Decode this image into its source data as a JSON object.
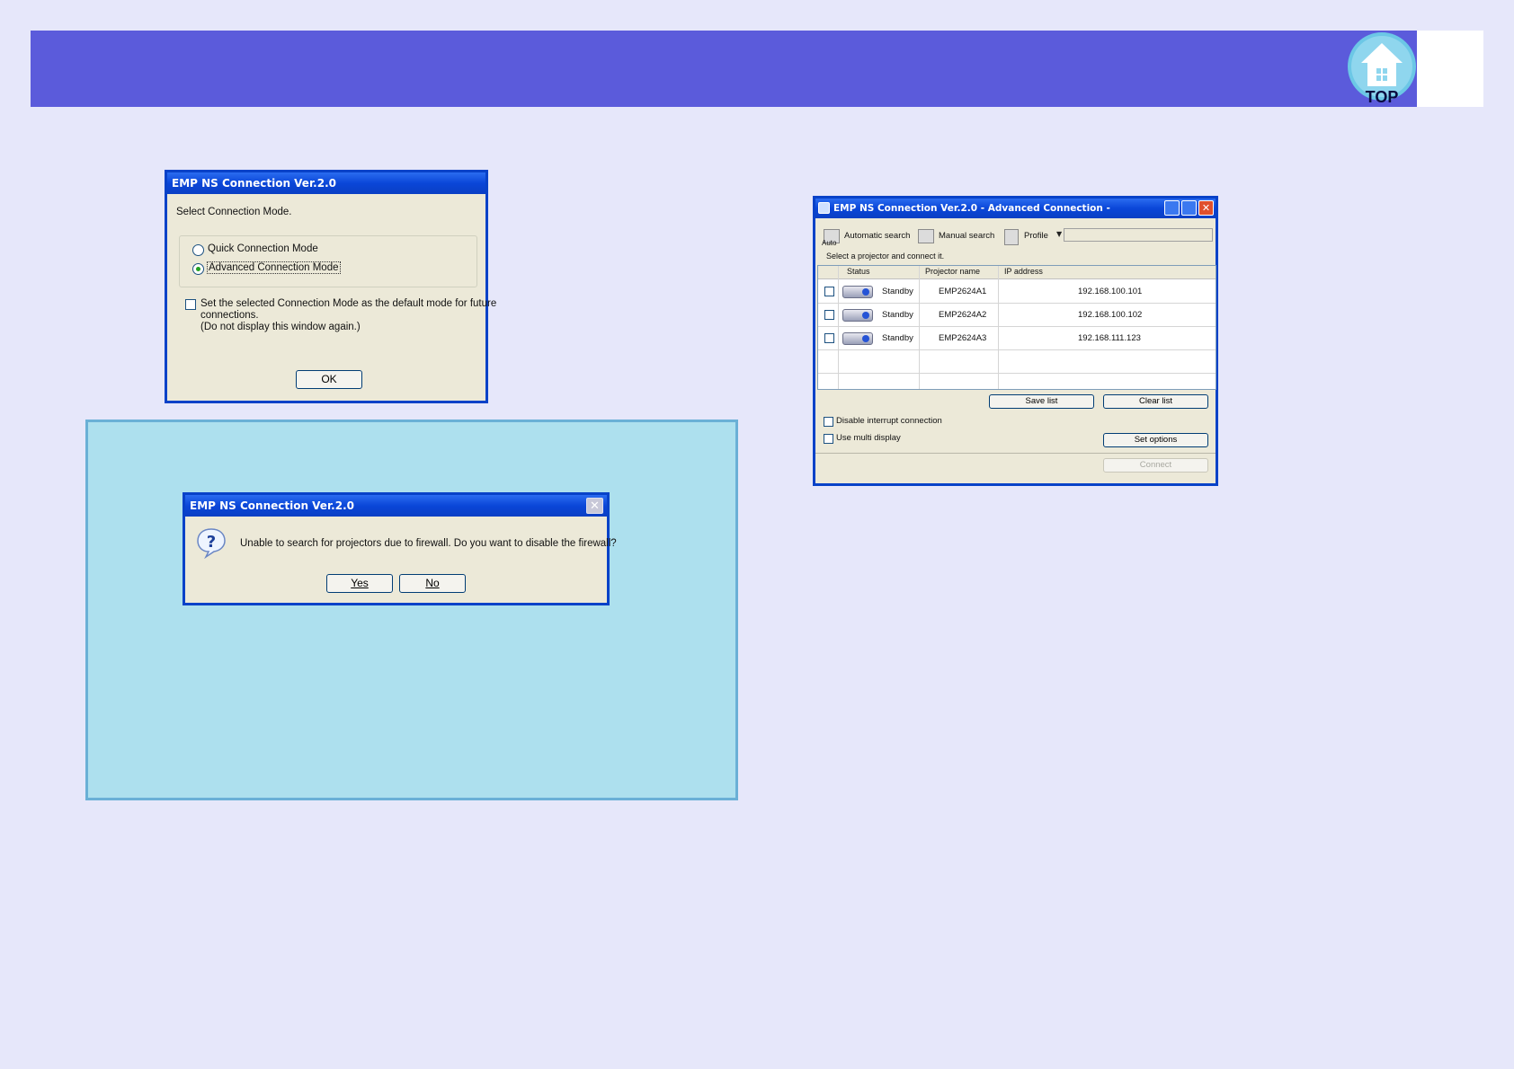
{
  "header": {
    "top_button_label": "TOP"
  },
  "dialog_mode": {
    "title": "EMP NS Connection Ver.2.0",
    "prompt": "Select Connection Mode.",
    "options": [
      {
        "label": "Quick Connection Mode",
        "selected": false
      },
      {
        "label": "Advanced Connection Mode",
        "selected": true
      }
    ],
    "default_checkbox_line1": "Set the selected Connection Mode as the default mode for future",
    "default_checkbox_line2": "connections.",
    "default_checkbox_line3": "(Do not display this window again.)",
    "ok_label": "OK"
  },
  "dialog_firewall": {
    "title": "EMP NS Connection Ver.2.0",
    "message": "Unable to search for projectors due to firewall. Do you want to disable the firewall?",
    "yes_label": "Yes",
    "no_label": "No"
  },
  "advanced_window": {
    "title": "EMP NS Connection Ver.2.0 - Advanced Connection -",
    "toolbar": {
      "auto_icon_text": "Auto",
      "automatic_search": "Automatic search",
      "manual_search": "Manual search",
      "profile": "Profile"
    },
    "instruction": "Select a projector and connect it.",
    "columns": [
      "Status",
      "Projector name",
      "IP address"
    ],
    "rows": [
      {
        "status": "Standby",
        "name": "EMP2624A1",
        "ip": "192.168.100.101"
      },
      {
        "status": "Standby",
        "name": "EMP2624A2",
        "ip": "192.168.100.102"
      },
      {
        "status": "Standby",
        "name": "EMP2624A3",
        "ip": "192.168.111.123"
      }
    ],
    "save_list": "Save list",
    "clear_list": "Clear list",
    "disable_interrupt": "Disable interrupt connection",
    "use_multi_display": "Use multi display",
    "set_options": "Set options",
    "connect": "Connect"
  }
}
